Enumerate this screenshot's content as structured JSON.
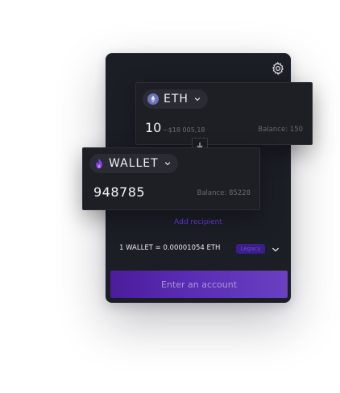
{
  "send": {
    "token": "ETH",
    "amount": "10",
    "fiat": "~$18 005,18",
    "balance": "Balance: 150"
  },
  "receive": {
    "token": "WALLET",
    "amount": "948785",
    "balance": "Balance: 85228"
  },
  "add_recipient": "Add recipient",
  "rate": "1 WALLET = 0.00001054 ETH",
  "legacy_badge": "Legacy",
  "cta_label": "Enter an account",
  "colors": {
    "card_bg": "#1c1e26",
    "panel_bg": "#1e1f25",
    "accent": "#5b2fc8",
    "eth_icon": "#6b74b8",
    "wallet_flame": "#8b3cf0"
  },
  "icons": [
    "gear-icon",
    "eth-icon",
    "flame-icon",
    "chevron-down-icon",
    "arrow-down-icon"
  ]
}
